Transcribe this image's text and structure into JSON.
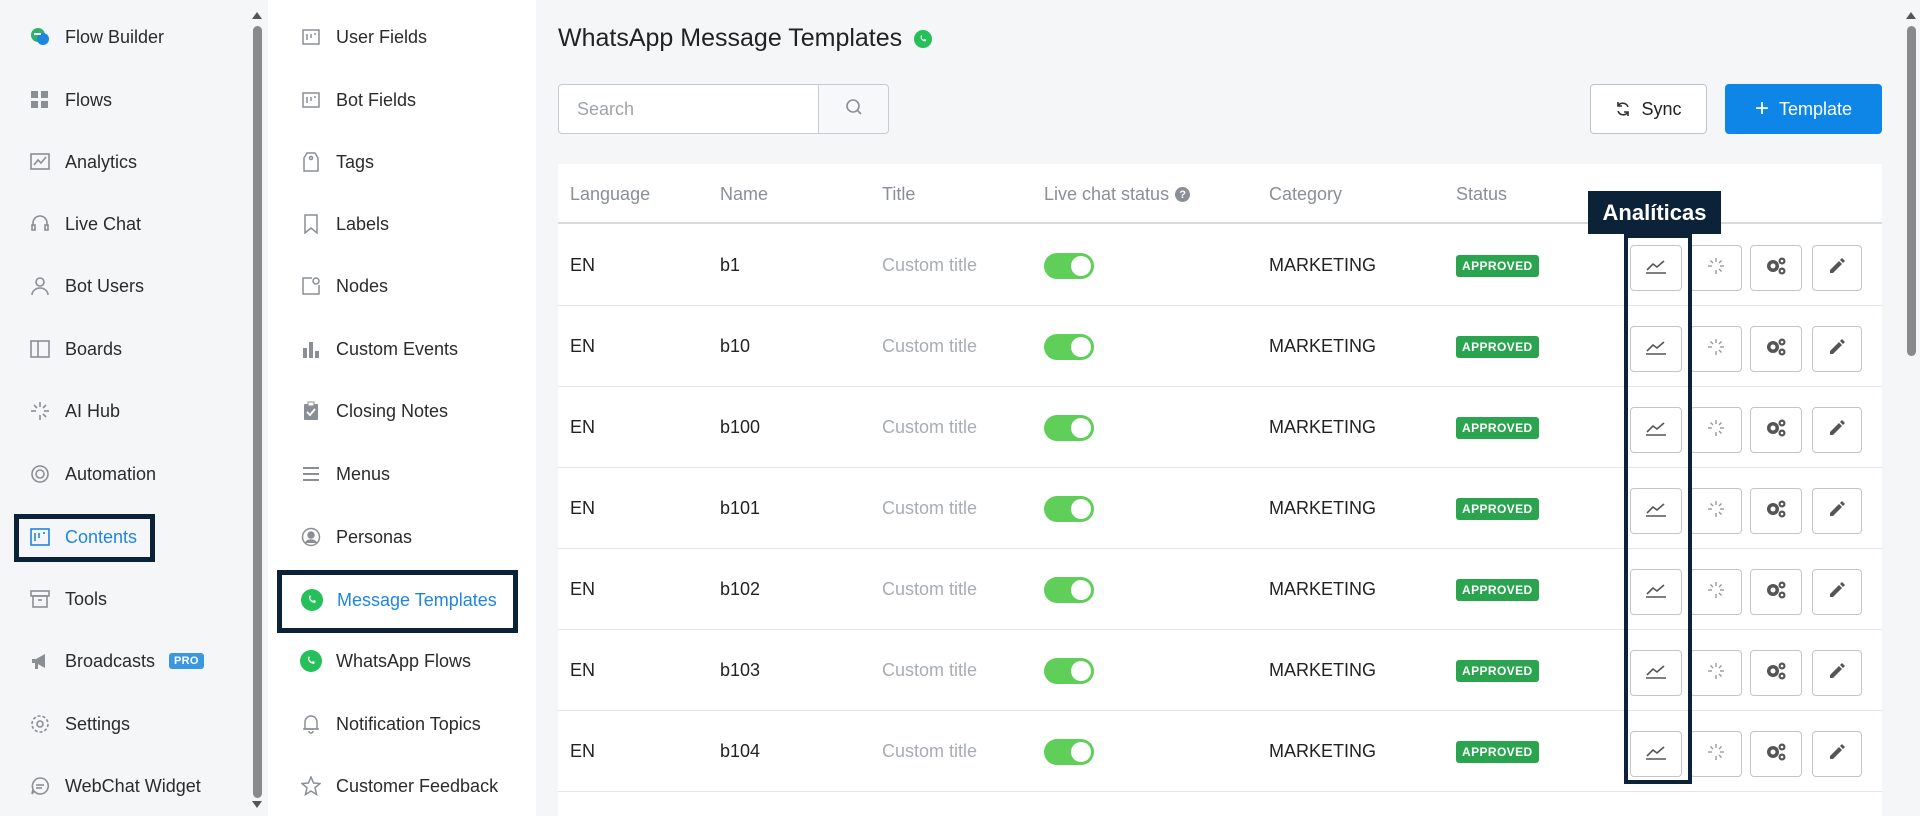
{
  "sidebar": {
    "items": [
      {
        "label": "Flow Builder",
        "icon": "flow-builder-icon"
      },
      {
        "label": "Flows",
        "icon": "grid-icon"
      },
      {
        "label": "Analytics",
        "icon": "analytics-icon"
      },
      {
        "label": "Live Chat",
        "icon": "headset-icon"
      },
      {
        "label": "Bot Users",
        "icon": "user-icon"
      },
      {
        "label": "Boards",
        "icon": "board-icon"
      },
      {
        "label": "AI Hub",
        "icon": "sparkle-icon"
      },
      {
        "label": "Automation",
        "icon": "automation-icon"
      },
      {
        "label": "Contents",
        "icon": "contents-icon",
        "active": true
      },
      {
        "label": "Tools",
        "icon": "archive-icon"
      },
      {
        "label": "Broadcasts",
        "icon": "megaphone-icon",
        "badge": "PRO"
      },
      {
        "label": "Settings",
        "icon": "gear-icon"
      },
      {
        "label": "WebChat Widget",
        "icon": "chat-icon"
      }
    ]
  },
  "subnav": {
    "items": [
      {
        "label": "User Fields",
        "icon": "field-icon"
      },
      {
        "label": "Bot Fields",
        "icon": "field-icon"
      },
      {
        "label": "Tags",
        "icon": "tag-icon"
      },
      {
        "label": "Labels",
        "icon": "bookmark-icon"
      },
      {
        "label": "Nodes",
        "icon": "node-icon"
      },
      {
        "label": "Custom Events",
        "icon": "bar-chart-icon"
      },
      {
        "label": "Closing Notes",
        "icon": "clipboard-icon"
      },
      {
        "label": "Menus",
        "icon": "menu-icon"
      },
      {
        "label": "Personas",
        "icon": "persona-icon"
      },
      {
        "label": "Message Templates",
        "icon": "whatsapp-icon",
        "active": true
      },
      {
        "label": "WhatsApp Flows",
        "icon": "whatsapp-icon"
      },
      {
        "label": "Notification Topics",
        "icon": "bell-icon"
      },
      {
        "label": "Customer Feedback",
        "icon": "star-icon"
      }
    ]
  },
  "main": {
    "title": "WhatsApp Message Templates",
    "search_placeholder": "Search",
    "sync_label": "Sync",
    "template_label": "Template",
    "tooltip": "Analíticas",
    "columns": {
      "language": "Language",
      "name": "Name",
      "title": "Title",
      "live_chat_status": "Live chat status",
      "category": "Category",
      "status": "Status"
    },
    "rows": [
      {
        "language": "EN",
        "name": "b1",
        "title": "Custom title",
        "live": true,
        "category": "MARKETING",
        "status": "APPROVED"
      },
      {
        "language": "EN",
        "name": "b10",
        "title": "Custom title",
        "live": true,
        "category": "MARKETING",
        "status": "APPROVED"
      },
      {
        "language": "EN",
        "name": "b100",
        "title": "Custom title",
        "live": true,
        "category": "MARKETING",
        "status": "APPROVED"
      },
      {
        "language": "EN",
        "name": "b101",
        "title": "Custom title",
        "live": true,
        "category": "MARKETING",
        "status": "APPROVED"
      },
      {
        "language": "EN",
        "name": "b102",
        "title": "Custom title",
        "live": true,
        "category": "MARKETING",
        "status": "APPROVED"
      },
      {
        "language": "EN",
        "name": "b103",
        "title": "Custom title",
        "live": true,
        "category": "MARKETING",
        "status": "APPROVED"
      },
      {
        "language": "EN",
        "name": "b104",
        "title": "Custom title",
        "live": true,
        "category": "MARKETING",
        "status": "APPROVED"
      }
    ]
  },
  "colors": {
    "accent": "#0e86e8",
    "active_nav": "#1f86e0",
    "toggle_on": "#5fcf5a",
    "approved": "#2aa44f",
    "highlight": "#0b2238"
  }
}
